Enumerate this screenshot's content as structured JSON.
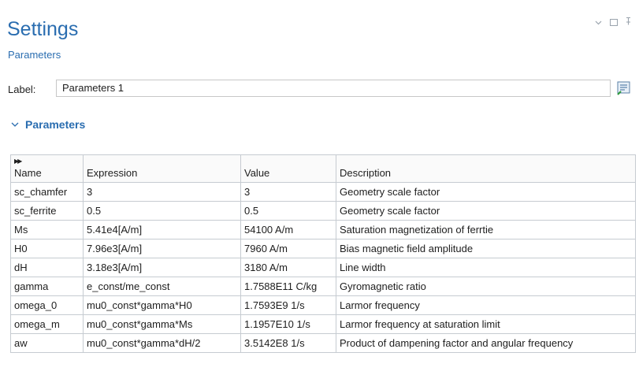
{
  "header": {
    "title": "Settings",
    "subtitle": "Parameters",
    "controls": [
      "chevron-down-icon",
      "maximize-icon",
      "pin-icon"
    ]
  },
  "label_row": {
    "label": "Label:",
    "value": "Parameters 1"
  },
  "section": {
    "title": "Parameters"
  },
  "table": {
    "columns": [
      "Name",
      "Expression",
      "Value",
      "Description"
    ],
    "rows": [
      {
        "name": "sc_chamfer",
        "expression": "3",
        "value": "3",
        "description": "Geometry scale factor"
      },
      {
        "name": "sc_ferrite",
        "expression": "0.5",
        "value": "0.5",
        "description": "Geometry scale factor"
      },
      {
        "name": "Ms",
        "expression": "5.41e4[A/m]",
        "value": "54100 A/m",
        "description": "Saturation magnetization of ferrtie"
      },
      {
        "name": "H0",
        "expression": "7.96e3[A/m]",
        "value": "7960 A/m",
        "description": "Bias magnetic field amplitude"
      },
      {
        "name": "dH",
        "expression": "3.18e3[A/m]",
        "value": "3180 A/m",
        "description": "Line width"
      },
      {
        "name": "gamma",
        "expression": "e_const/me_const",
        "value": "1.7588E11 C/kg",
        "description": "Gyromagnetic ratio"
      },
      {
        "name": "omega_0",
        "expression": "mu0_const*gamma*H0",
        "value": "1.7593E9 1/s",
        "description": "Larmor frequency"
      },
      {
        "name": "omega_m",
        "expression": "mu0_const*gamma*Ms",
        "value": "1.1957E10 1/s",
        "description": "Larmor frequency at saturation limit"
      },
      {
        "name": "aw",
        "expression": "mu0_const*gamma*dH/2",
        "value": "3.5142E8 1/s",
        "description": "Product of dampening factor and angular frequency"
      }
    ]
  },
  "colors": {
    "accent": "#2a6db0",
    "border": "#c6cbd1"
  }
}
